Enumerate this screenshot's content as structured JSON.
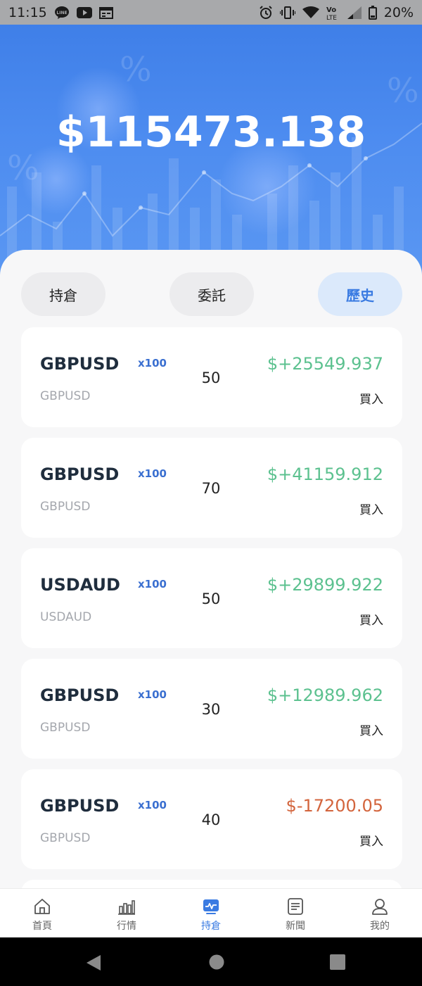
{
  "status_bar": {
    "time": "11:15",
    "battery": "20%",
    "left_icons": [
      "line-icon",
      "youtube-icon",
      "calendar-icon"
    ],
    "right_icons": [
      "alarm-icon",
      "vibrate-icon",
      "wifi-icon",
      "volte-icon",
      "signal-icon",
      "battery-icon"
    ]
  },
  "header": {
    "balance": "$115473.138"
  },
  "tabs": [
    {
      "label": "持倉",
      "active": false
    },
    {
      "label": "委託",
      "active": false
    },
    {
      "label": "歷史",
      "active": true
    }
  ],
  "positions": [
    {
      "symbol": "GBPUSD",
      "leverage": "x100",
      "subtitle": "GBPUSD",
      "quantity": "50",
      "pnl": "$+25549.937",
      "side": "買入",
      "negative": false
    },
    {
      "symbol": "GBPUSD",
      "leverage": "x100",
      "subtitle": "GBPUSD",
      "quantity": "70",
      "pnl": "$+41159.912",
      "side": "買入",
      "negative": false
    },
    {
      "symbol": "USDAUD",
      "leverage": "x100",
      "subtitle": "USDAUD",
      "quantity": "50",
      "pnl": "$+29899.922",
      "side": "買入",
      "negative": false
    },
    {
      "symbol": "GBPUSD",
      "leverage": "x100",
      "subtitle": "GBPUSD",
      "quantity": "30",
      "pnl": "$+12989.962",
      "side": "買入",
      "negative": false
    },
    {
      "symbol": "GBPUSD",
      "leverage": "x100",
      "subtitle": "GBPUSD",
      "quantity": "40",
      "pnl": "$-17200.05",
      "side": "買入",
      "negative": true
    }
  ],
  "bottom_nav": [
    {
      "label": "首頁",
      "icon": "home-icon",
      "active": false
    },
    {
      "label": "行情",
      "icon": "market-chart-icon",
      "active": false
    },
    {
      "label": "持倉",
      "icon": "holdings-icon",
      "active": true
    },
    {
      "label": "新聞",
      "icon": "news-icon",
      "active": false
    },
    {
      "label": "我的",
      "icon": "profile-icon",
      "active": false
    }
  ],
  "colors": {
    "accent": "#3a7be2",
    "gain": "#5cc18f",
    "loss": "#d3643c",
    "header_blue": "#4d8cf0"
  }
}
